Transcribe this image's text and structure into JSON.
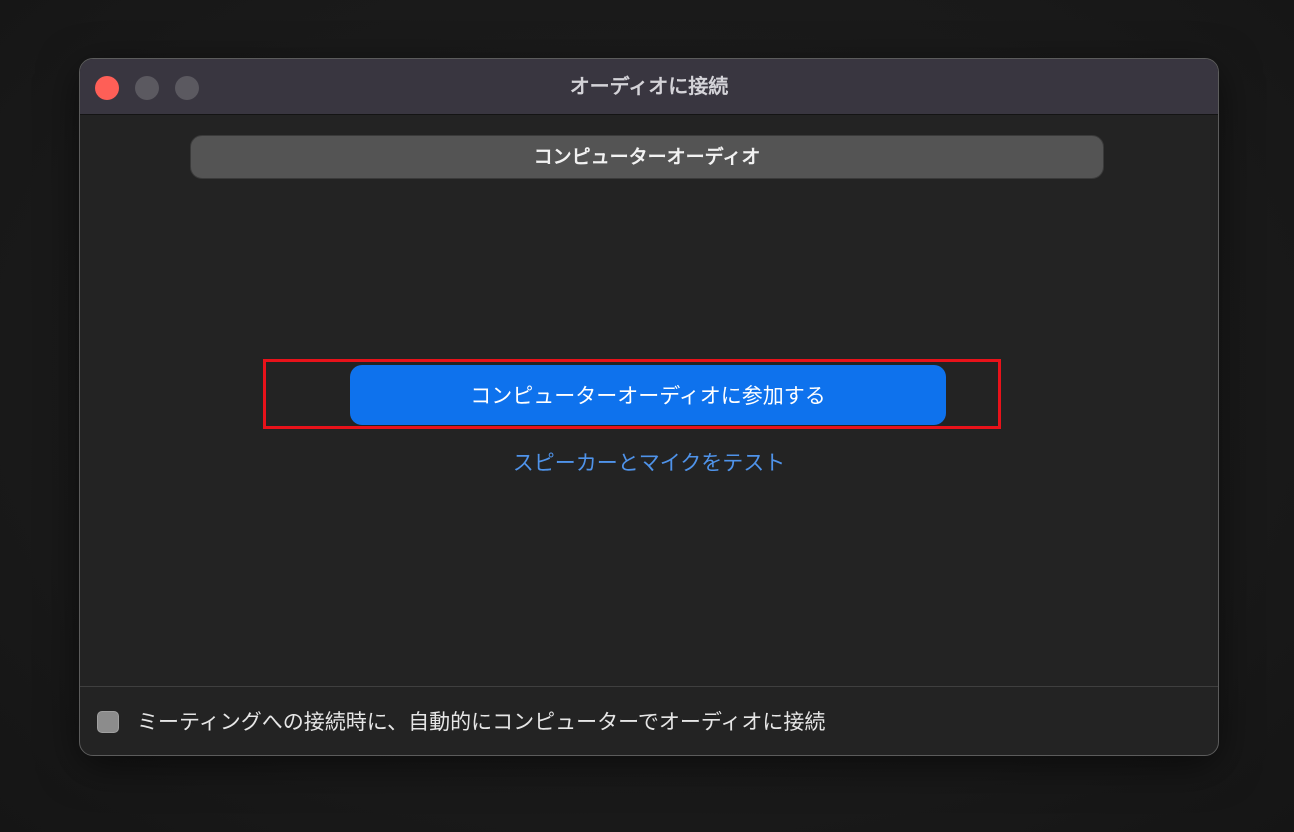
{
  "window": {
    "title": "オーディオに接続"
  },
  "tabs": {
    "active_label": "コンピューターオーディオ"
  },
  "main": {
    "join_button_label": "コンピューターオーディオに参加する",
    "test_link_label": "スピーカーとマイクをテスト"
  },
  "footer": {
    "auto_join_label": "ミーティングへの接続時に、自動的にコンピューターでオーディオに接続",
    "auto_join_checked": false
  },
  "colors": {
    "accent": "#0e72ed",
    "link": "#4f93ea",
    "highlight": "#e8121a",
    "close_button": "#fe5f57"
  }
}
